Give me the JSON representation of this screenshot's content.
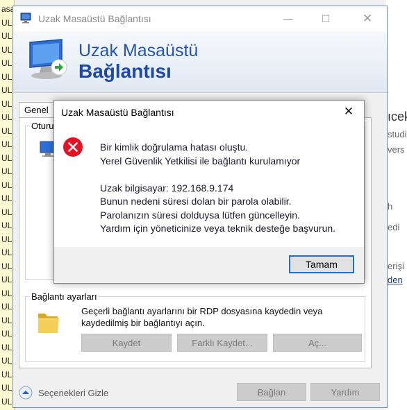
{
  "background": {
    "left_lines": [
      "asa",
      "UL",
      "UL",
      "UL",
      "UL",
      "UL",
      "UL",
      "UL",
      "UL",
      "UL",
      "UL",
      "UL",
      "UL",
      "UL",
      "UL",
      "UL",
      "UL",
      "UL",
      "UL",
      "UL",
      "UL",
      "UL",
      "UL",
      "UL",
      "UL",
      "UL",
      "UL",
      "UL",
      "UL",
      "UL"
    ],
    "right_fragments": [
      "ıcek",
      "studi",
      "vers",
      "h",
      "edi",
      "erişi",
      "den"
    ]
  },
  "main_window": {
    "title": "Uzak Masaüstü Bağlantısı",
    "banner_line1": "Uzak Masaüstü",
    "banner_line2": "Bağlantısı",
    "tab_general": "Genel",
    "group_login_caption": "Oturum",
    "group_connection_caption": "Bağlantı ayarları",
    "connection_description": "Geçerli bağlantı ayarlarını bir RDP dosyasına kaydedin veya kaydedilmiş bir bağlantıyı açın.",
    "save_label": "Kaydet",
    "save_as_label": "Farklı Kaydet...",
    "open_label": "Aç...",
    "hide_options_label": "Seçenekleri Gizle",
    "connect_label": "Bağlan",
    "help_label": "Yardım"
  },
  "error_dialog": {
    "title": "Uzak Masaüstü Bağlantısı",
    "line1": "Bir kimlik doğrulama hatası oluştu.",
    "line2": "Yerel Güvenlik Yetkilisi ile bağlantı kurulamıyor",
    "line3": "Uzak bilgisayar: 192.168.9.174",
    "line4": "Bunun nedeni süresi dolan bir parola olabilir.",
    "line5": "Parolanızın süresi dolduysa lütfen güncelleyin.",
    "line6": "Yardım için yöneticinize veya teknik desteğe başvurun.",
    "ok_label": "Tamam"
  },
  "colors": {
    "accent_blue": "#1f6fd1",
    "banner_text": "#2255b8",
    "error_red": "#e81123"
  }
}
